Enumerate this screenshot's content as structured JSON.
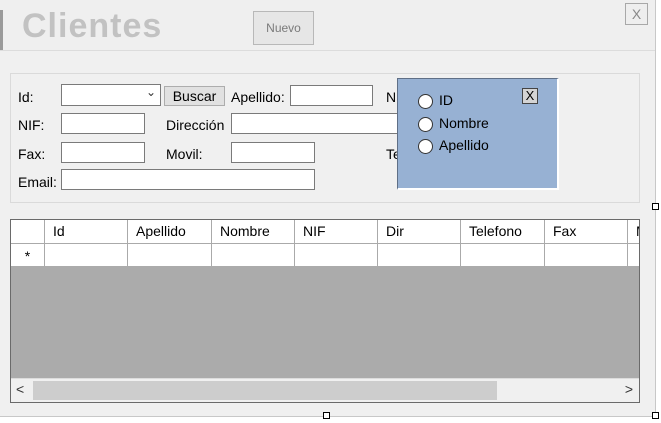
{
  "header": {
    "title": "Clientes",
    "nuevo_label": "Nuevo",
    "close_label": "X"
  },
  "search": {
    "id_label": "Id:",
    "buscar_label": "Buscar",
    "apellido_label": "Apellido:",
    "nombre_label_partial": "N",
    "nif_label": "NIF:",
    "direccion_label": "Dirección",
    "fax_label": "Fax:",
    "movil_label": "Movil:",
    "telefono_label_partial": "Te",
    "email_label": "Email:"
  },
  "popup": {
    "close_label": "X",
    "options": [
      "ID",
      "Nombre",
      "Apellido"
    ]
  },
  "grid": {
    "columns": [
      "Id",
      "Apellido",
      "Nombre",
      "NIF",
      "Dir",
      "Telefono",
      "Fax",
      "M"
    ],
    "new_row_marker": "*",
    "scroll_left": "<",
    "scroll_right": ">"
  },
  "colors": {
    "popup_bg": "#97b1d3",
    "grid_bg": "#ababab",
    "form_bg": "#f0f0f0"
  }
}
